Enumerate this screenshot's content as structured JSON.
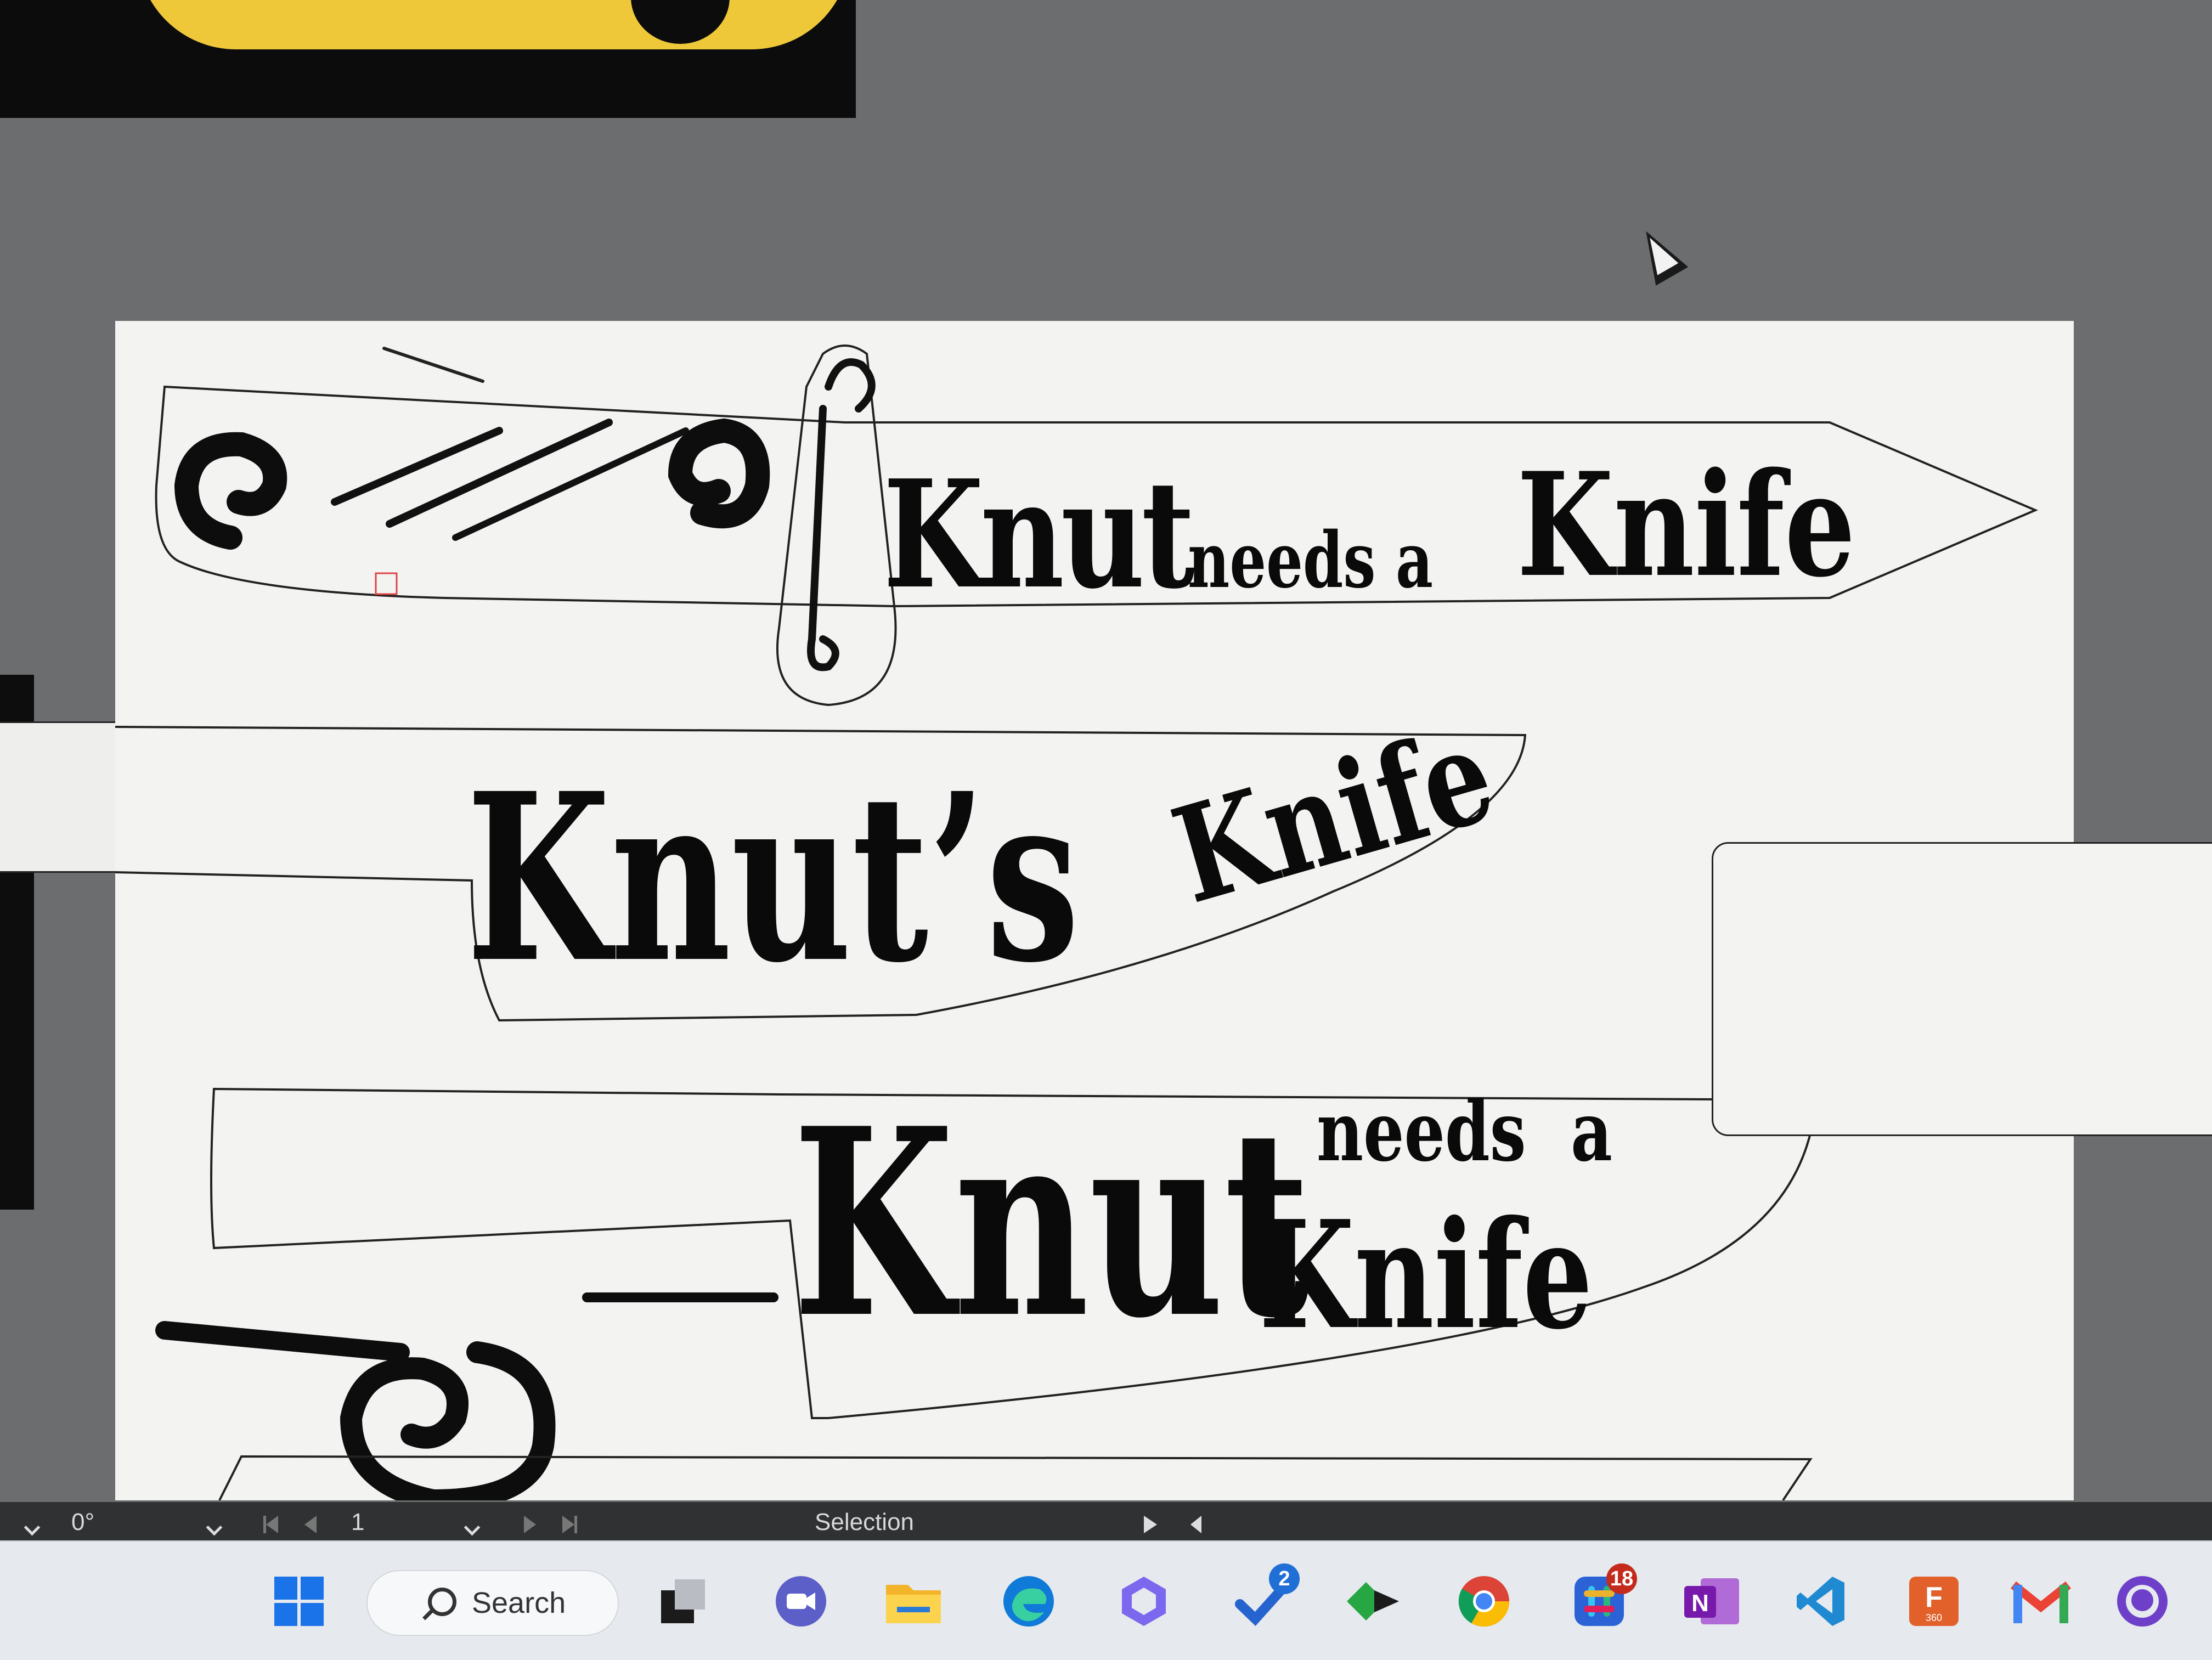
{
  "artwork": {
    "knife1_text": {
      "word1": "Knut",
      "word2": "needs a",
      "word3": "Knife"
    },
    "knife2_text": {
      "word1": "Knut’s",
      "word2": "Knife"
    },
    "knife3_text": {
      "small": "needs  a",
      "big": "Knut",
      "word3": "Knife"
    }
  },
  "statusbar": {
    "rotation": "0°",
    "page_number": "1",
    "tool_label": "Selection"
  },
  "taskbar": {
    "search_label": "Search",
    "badges": {
      "edge_tasks": "2",
      "slack": "18"
    },
    "app_letters": {
      "onenote": "N",
      "fusion": "F",
      "fusion_sub": "360"
    }
  },
  "colors": {
    "canvas_bg": "#6b6d6e",
    "artboard": "#f3f4f2",
    "statusbar": "#2f3133",
    "taskbar": "#e6e9ee",
    "accent_yellow": "#efc83a"
  }
}
